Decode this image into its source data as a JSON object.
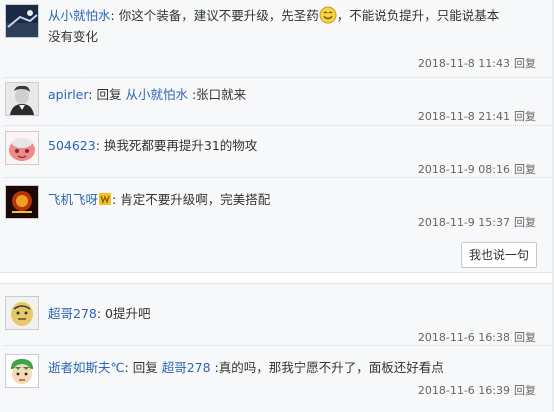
{
  "thread1": {
    "replies": [
      {
        "user": "从小就怕水",
        "sep": ": ",
        "text_before_emoji": "你这个装备，建议不要升级，先圣药",
        "emoji": "smile-emoji",
        "text_after_emoji": "，不能说负提升，只能说基本",
        "text_line2": "没有变化",
        "time": "2018-11-8 11:43",
        "reply_label": "回复"
      },
      {
        "user": "apirler",
        "sep": ": ",
        "reply_word": "回复 ",
        "mention": "从小就怕水",
        "text": " :张口就来",
        "time": "2018-11-8 21:41",
        "reply_label": "回复"
      },
      {
        "user": "504623",
        "sep": ": ",
        "text": "换我死都要再提升31的物攻",
        "time": "2018-11-9 08:16",
        "reply_label": "回复"
      },
      {
        "user": "飞机飞呀",
        "sep": ": ",
        "text": "肯定不要升级啊，完美搭配",
        "time": "2018-11-9 15:37",
        "reply_label": "回复"
      }
    ],
    "say_button": "我也说一句"
  },
  "thread2": {
    "replies": [
      {
        "user": "超哥278",
        "sep": ": ",
        "text": "0提升吧",
        "time": "2018-11-6 16:38",
        "reply_label": "回复"
      },
      {
        "user": "逝者如斯夫℃",
        "sep": ": ",
        "reply_word": "回复 ",
        "mention": "超哥278",
        "text": " :真的吗，那我宁愿不升了，面板还好看点",
        "time": "2018-11-6 16:39",
        "reply_label": "回复"
      }
    ]
  },
  "colors": {
    "link": "#2d64b3",
    "panel_bg": "#f7f8fa",
    "meta_text": "#666666"
  }
}
